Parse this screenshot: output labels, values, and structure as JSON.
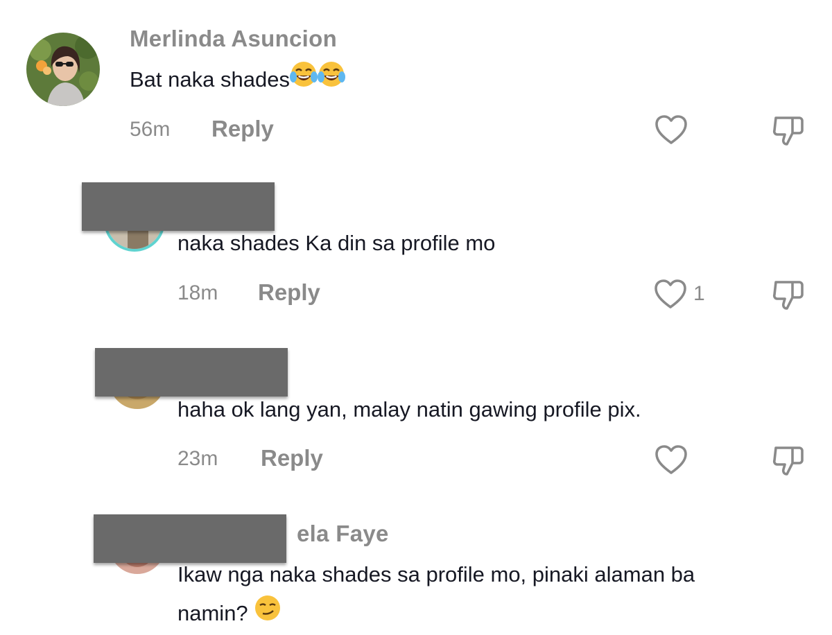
{
  "comments": [
    {
      "username": "Merlinda Asuncion",
      "text": "Bat naka shades",
      "emoji": [
        "joy-emoji",
        "joy-emoji"
      ],
      "time": "56m",
      "reply_label": "Reply",
      "likes": ""
    },
    {
      "username": "",
      "text": "naka shades Ka din sa profile mo",
      "time": "18m",
      "reply_label": "Reply",
      "likes": "1"
    },
    {
      "username": "",
      "text": "haha ok lang yan, malay natin gawing profile pix.",
      "time": "23m",
      "reply_label": "Reply",
      "likes": ""
    },
    {
      "username": "ela Faye",
      "text_line1": "Ikaw nga naka shades sa profile mo, pinaki alaman ba",
      "text_line2": "namin?",
      "emoji": [
        "smirk-emoji"
      ],
      "time": "",
      "reply_label": ""
    }
  ],
  "icons": {
    "like": "heart-outline-icon",
    "dislike": "thumbs-down-icon"
  },
  "colors": {
    "muted_text": "#8a8a8a",
    "body_text": "#161823",
    "redaction": "#6a6a6a",
    "avatar_ring": "#5fd3d0"
  }
}
